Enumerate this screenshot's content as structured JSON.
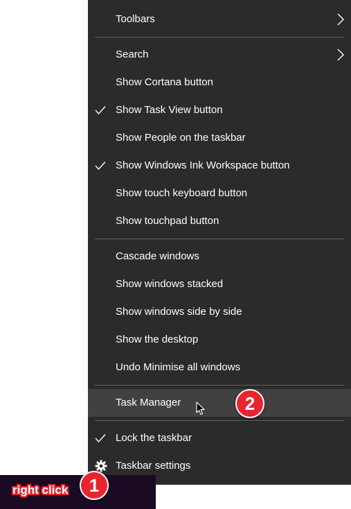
{
  "menu": {
    "toolbars": "Toolbars",
    "search": "Search",
    "show_cortana": "Show Cortana button",
    "show_task_view": "Show Task View button",
    "show_people": "Show People on the taskbar",
    "show_ink_workspace": "Show Windows Ink Workspace button",
    "show_touch_keyboard": "Show touch keyboard button",
    "show_touchpad": "Show touchpad button",
    "cascade": "Cascade windows",
    "stacked": "Show windows stacked",
    "side_by_side": "Show windows side by side",
    "show_desktop": "Show the desktop",
    "undo_minimise": "Undo Minimise all windows",
    "task_manager": "Task Manager",
    "lock_taskbar": "Lock the taskbar",
    "taskbar_settings": "Taskbar settings"
  },
  "checked": {
    "show_task_view": true,
    "show_ink_workspace": true,
    "lock_taskbar": true
  },
  "annotations": {
    "step1_number": "1",
    "step1_label": "right click",
    "step2_number": "2"
  },
  "colors": {
    "menu_bg": "#2b2b2b",
    "hover_bg": "#414141",
    "separator": "#5f5f5f",
    "badge": "#e8252f",
    "taskbar": "#1a0a23"
  },
  "icons": {
    "submenu": "chevron-right-icon",
    "check": "checkmark-icon",
    "settings": "gear-icon",
    "pointer": "mouse-cursor-icon"
  }
}
